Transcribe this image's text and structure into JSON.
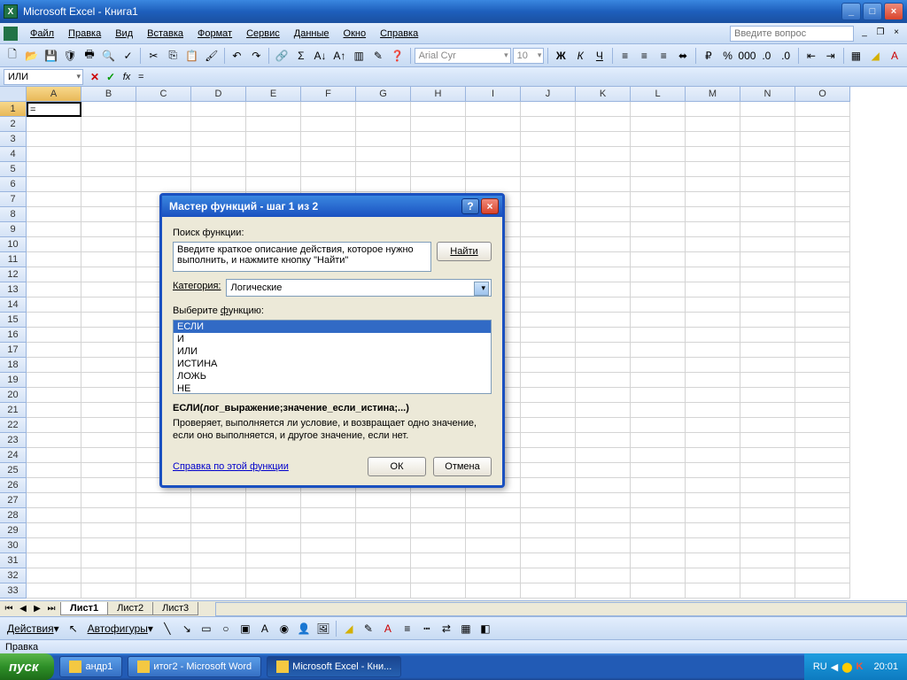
{
  "titlebar": {
    "title": "Microsoft Excel - Книга1"
  },
  "menu": {
    "items": [
      "Файл",
      "Правка",
      "Вид",
      "Вставка",
      "Формат",
      "Сервис",
      "Данные",
      "Окно",
      "Справка"
    ],
    "question_placeholder": "Введите вопрос"
  },
  "toolbar": {
    "font_name": "Arial Cyr",
    "font_size": "10"
  },
  "formulabar": {
    "namebox": "ИЛИ",
    "formula": "="
  },
  "sheet": {
    "columns": [
      "A",
      "B",
      "C",
      "D",
      "E",
      "F",
      "G",
      "H",
      "I",
      "J",
      "K",
      "L",
      "M",
      "N",
      "O"
    ],
    "rows": 33,
    "active_cell": "A1",
    "a1_value": "="
  },
  "dialog": {
    "title": "Мастер функций - шаг 1 из 2",
    "search_label": "Поиск функции:",
    "search_text": "Введите краткое описание действия, которое нужно выполнить, и нажмите кнопку \"Найти\"",
    "find_btn": "Найти",
    "category_label": "Категория:",
    "category_value": "Логические",
    "select_label": "Выберите функцию:",
    "functions": [
      "ЕСЛИ",
      "И",
      "ИЛИ",
      "ИСТИНА",
      "ЛОЖЬ",
      "НЕ"
    ],
    "selected_function": "ЕСЛИ",
    "syntax": "ЕСЛИ(лог_выражение;значение_если_истина;...)",
    "description": "Проверяет, выполняется ли условие, и возвращает одно значение, если оно выполняется, и другое значение, если нет.",
    "help_link": "Справка по этой функции",
    "ok": "ОК",
    "cancel": "Отмена"
  },
  "tabs": {
    "sheets": [
      "Лист1",
      "Лист2",
      "Лист3"
    ],
    "active": "Лист1"
  },
  "drawbar": {
    "actions": "Действия",
    "autoshapes": "Автофигуры"
  },
  "statusbar": {
    "text": "Правка"
  },
  "taskbar": {
    "start": "пуск",
    "items": [
      {
        "label": "андр1",
        "active": false
      },
      {
        "label": "итог2 - Microsoft Word",
        "active": false
      },
      {
        "label": "Microsoft Excel - Кни...",
        "active": true
      }
    ],
    "lang": "RU",
    "time": "20:01"
  }
}
